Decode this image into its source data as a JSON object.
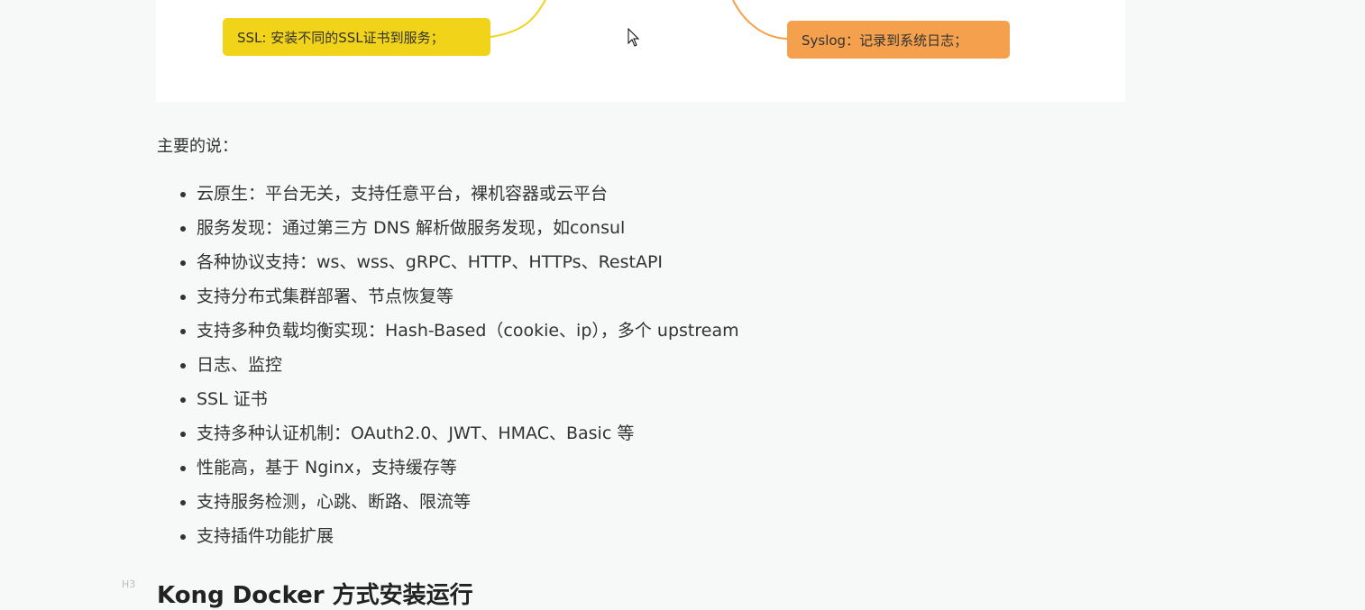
{
  "mindmap": {
    "nodes": [
      {
        "label": "SSL: 安装不同的SSL证书到服务；",
        "color": "#f1d31a"
      },
      {
        "label": "Syslog：记录到系统日志；",
        "color": "#f4a04c"
      }
    ]
  },
  "intro": "主要的说：",
  "features": [
    "云原生：平台无关，支持任意平台，裸机容器或云平台",
    "服务发现：通过第三方 DNS 解析做服务发现，如consul",
    "各种协议支持：ws、wss、gRPC、HTTP、HTTPs、RestAPI",
    "支持分布式集群部署、节点恢复等",
    "支持多种负载均衡实现：Hash-Based（cookie、ip），多个 upstream",
    "日志、监控",
    "SSL 证书",
    "支持多种认证机制：OAuth2.0、JWT、HMAC、Basic 等",
    "性能高，基于 Nginx，支持缓存等",
    "支持服务检测，心跳、断路、限流等",
    "支持插件功能扩展"
  ],
  "heading": {
    "level_tag": "H3",
    "text": "Kong Docker 方式安装运行"
  }
}
